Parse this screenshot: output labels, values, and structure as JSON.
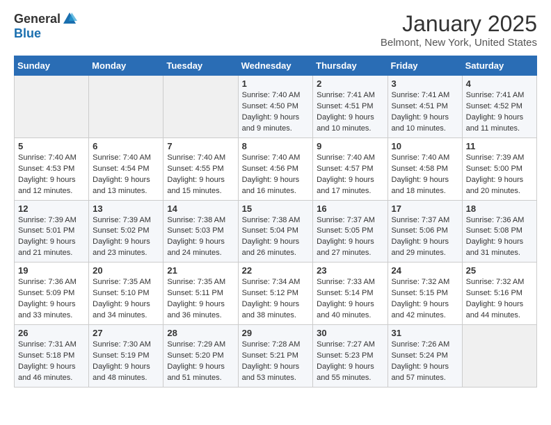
{
  "header": {
    "logo_general": "General",
    "logo_blue": "Blue",
    "month_title": "January 2025",
    "location": "Belmont, New York, United States"
  },
  "weekdays": [
    "Sunday",
    "Monday",
    "Tuesday",
    "Wednesday",
    "Thursday",
    "Friday",
    "Saturday"
  ],
  "weeks": [
    [
      {
        "day": "",
        "text": ""
      },
      {
        "day": "",
        "text": ""
      },
      {
        "day": "",
        "text": ""
      },
      {
        "day": "1",
        "text": "Sunrise: 7:40 AM\nSunset: 4:50 PM\nDaylight: 9 hours and 9 minutes."
      },
      {
        "day": "2",
        "text": "Sunrise: 7:41 AM\nSunset: 4:51 PM\nDaylight: 9 hours and 10 minutes."
      },
      {
        "day": "3",
        "text": "Sunrise: 7:41 AM\nSunset: 4:51 PM\nDaylight: 9 hours and 10 minutes."
      },
      {
        "day": "4",
        "text": "Sunrise: 7:41 AM\nSunset: 4:52 PM\nDaylight: 9 hours and 11 minutes."
      }
    ],
    [
      {
        "day": "5",
        "text": "Sunrise: 7:40 AM\nSunset: 4:53 PM\nDaylight: 9 hours and 12 minutes."
      },
      {
        "day": "6",
        "text": "Sunrise: 7:40 AM\nSunset: 4:54 PM\nDaylight: 9 hours and 13 minutes."
      },
      {
        "day": "7",
        "text": "Sunrise: 7:40 AM\nSunset: 4:55 PM\nDaylight: 9 hours and 15 minutes."
      },
      {
        "day": "8",
        "text": "Sunrise: 7:40 AM\nSunset: 4:56 PM\nDaylight: 9 hours and 16 minutes."
      },
      {
        "day": "9",
        "text": "Sunrise: 7:40 AM\nSunset: 4:57 PM\nDaylight: 9 hours and 17 minutes."
      },
      {
        "day": "10",
        "text": "Sunrise: 7:40 AM\nSunset: 4:58 PM\nDaylight: 9 hours and 18 minutes."
      },
      {
        "day": "11",
        "text": "Sunrise: 7:39 AM\nSunset: 5:00 PM\nDaylight: 9 hours and 20 minutes."
      }
    ],
    [
      {
        "day": "12",
        "text": "Sunrise: 7:39 AM\nSunset: 5:01 PM\nDaylight: 9 hours and 21 minutes."
      },
      {
        "day": "13",
        "text": "Sunrise: 7:39 AM\nSunset: 5:02 PM\nDaylight: 9 hours and 23 minutes."
      },
      {
        "day": "14",
        "text": "Sunrise: 7:38 AM\nSunset: 5:03 PM\nDaylight: 9 hours and 24 minutes."
      },
      {
        "day": "15",
        "text": "Sunrise: 7:38 AM\nSunset: 5:04 PM\nDaylight: 9 hours and 26 minutes."
      },
      {
        "day": "16",
        "text": "Sunrise: 7:37 AM\nSunset: 5:05 PM\nDaylight: 9 hours and 27 minutes."
      },
      {
        "day": "17",
        "text": "Sunrise: 7:37 AM\nSunset: 5:06 PM\nDaylight: 9 hours and 29 minutes."
      },
      {
        "day": "18",
        "text": "Sunrise: 7:36 AM\nSunset: 5:08 PM\nDaylight: 9 hours and 31 minutes."
      }
    ],
    [
      {
        "day": "19",
        "text": "Sunrise: 7:36 AM\nSunset: 5:09 PM\nDaylight: 9 hours and 33 minutes."
      },
      {
        "day": "20",
        "text": "Sunrise: 7:35 AM\nSunset: 5:10 PM\nDaylight: 9 hours and 34 minutes."
      },
      {
        "day": "21",
        "text": "Sunrise: 7:35 AM\nSunset: 5:11 PM\nDaylight: 9 hours and 36 minutes."
      },
      {
        "day": "22",
        "text": "Sunrise: 7:34 AM\nSunset: 5:12 PM\nDaylight: 9 hours and 38 minutes."
      },
      {
        "day": "23",
        "text": "Sunrise: 7:33 AM\nSunset: 5:14 PM\nDaylight: 9 hours and 40 minutes."
      },
      {
        "day": "24",
        "text": "Sunrise: 7:32 AM\nSunset: 5:15 PM\nDaylight: 9 hours and 42 minutes."
      },
      {
        "day": "25",
        "text": "Sunrise: 7:32 AM\nSunset: 5:16 PM\nDaylight: 9 hours and 44 minutes."
      }
    ],
    [
      {
        "day": "26",
        "text": "Sunrise: 7:31 AM\nSunset: 5:18 PM\nDaylight: 9 hours and 46 minutes."
      },
      {
        "day": "27",
        "text": "Sunrise: 7:30 AM\nSunset: 5:19 PM\nDaylight: 9 hours and 48 minutes."
      },
      {
        "day": "28",
        "text": "Sunrise: 7:29 AM\nSunset: 5:20 PM\nDaylight: 9 hours and 51 minutes."
      },
      {
        "day": "29",
        "text": "Sunrise: 7:28 AM\nSunset: 5:21 PM\nDaylight: 9 hours and 53 minutes."
      },
      {
        "day": "30",
        "text": "Sunrise: 7:27 AM\nSunset: 5:23 PM\nDaylight: 9 hours and 55 minutes."
      },
      {
        "day": "31",
        "text": "Sunrise: 7:26 AM\nSunset: 5:24 PM\nDaylight: 9 hours and 57 minutes."
      },
      {
        "day": "",
        "text": ""
      }
    ]
  ]
}
